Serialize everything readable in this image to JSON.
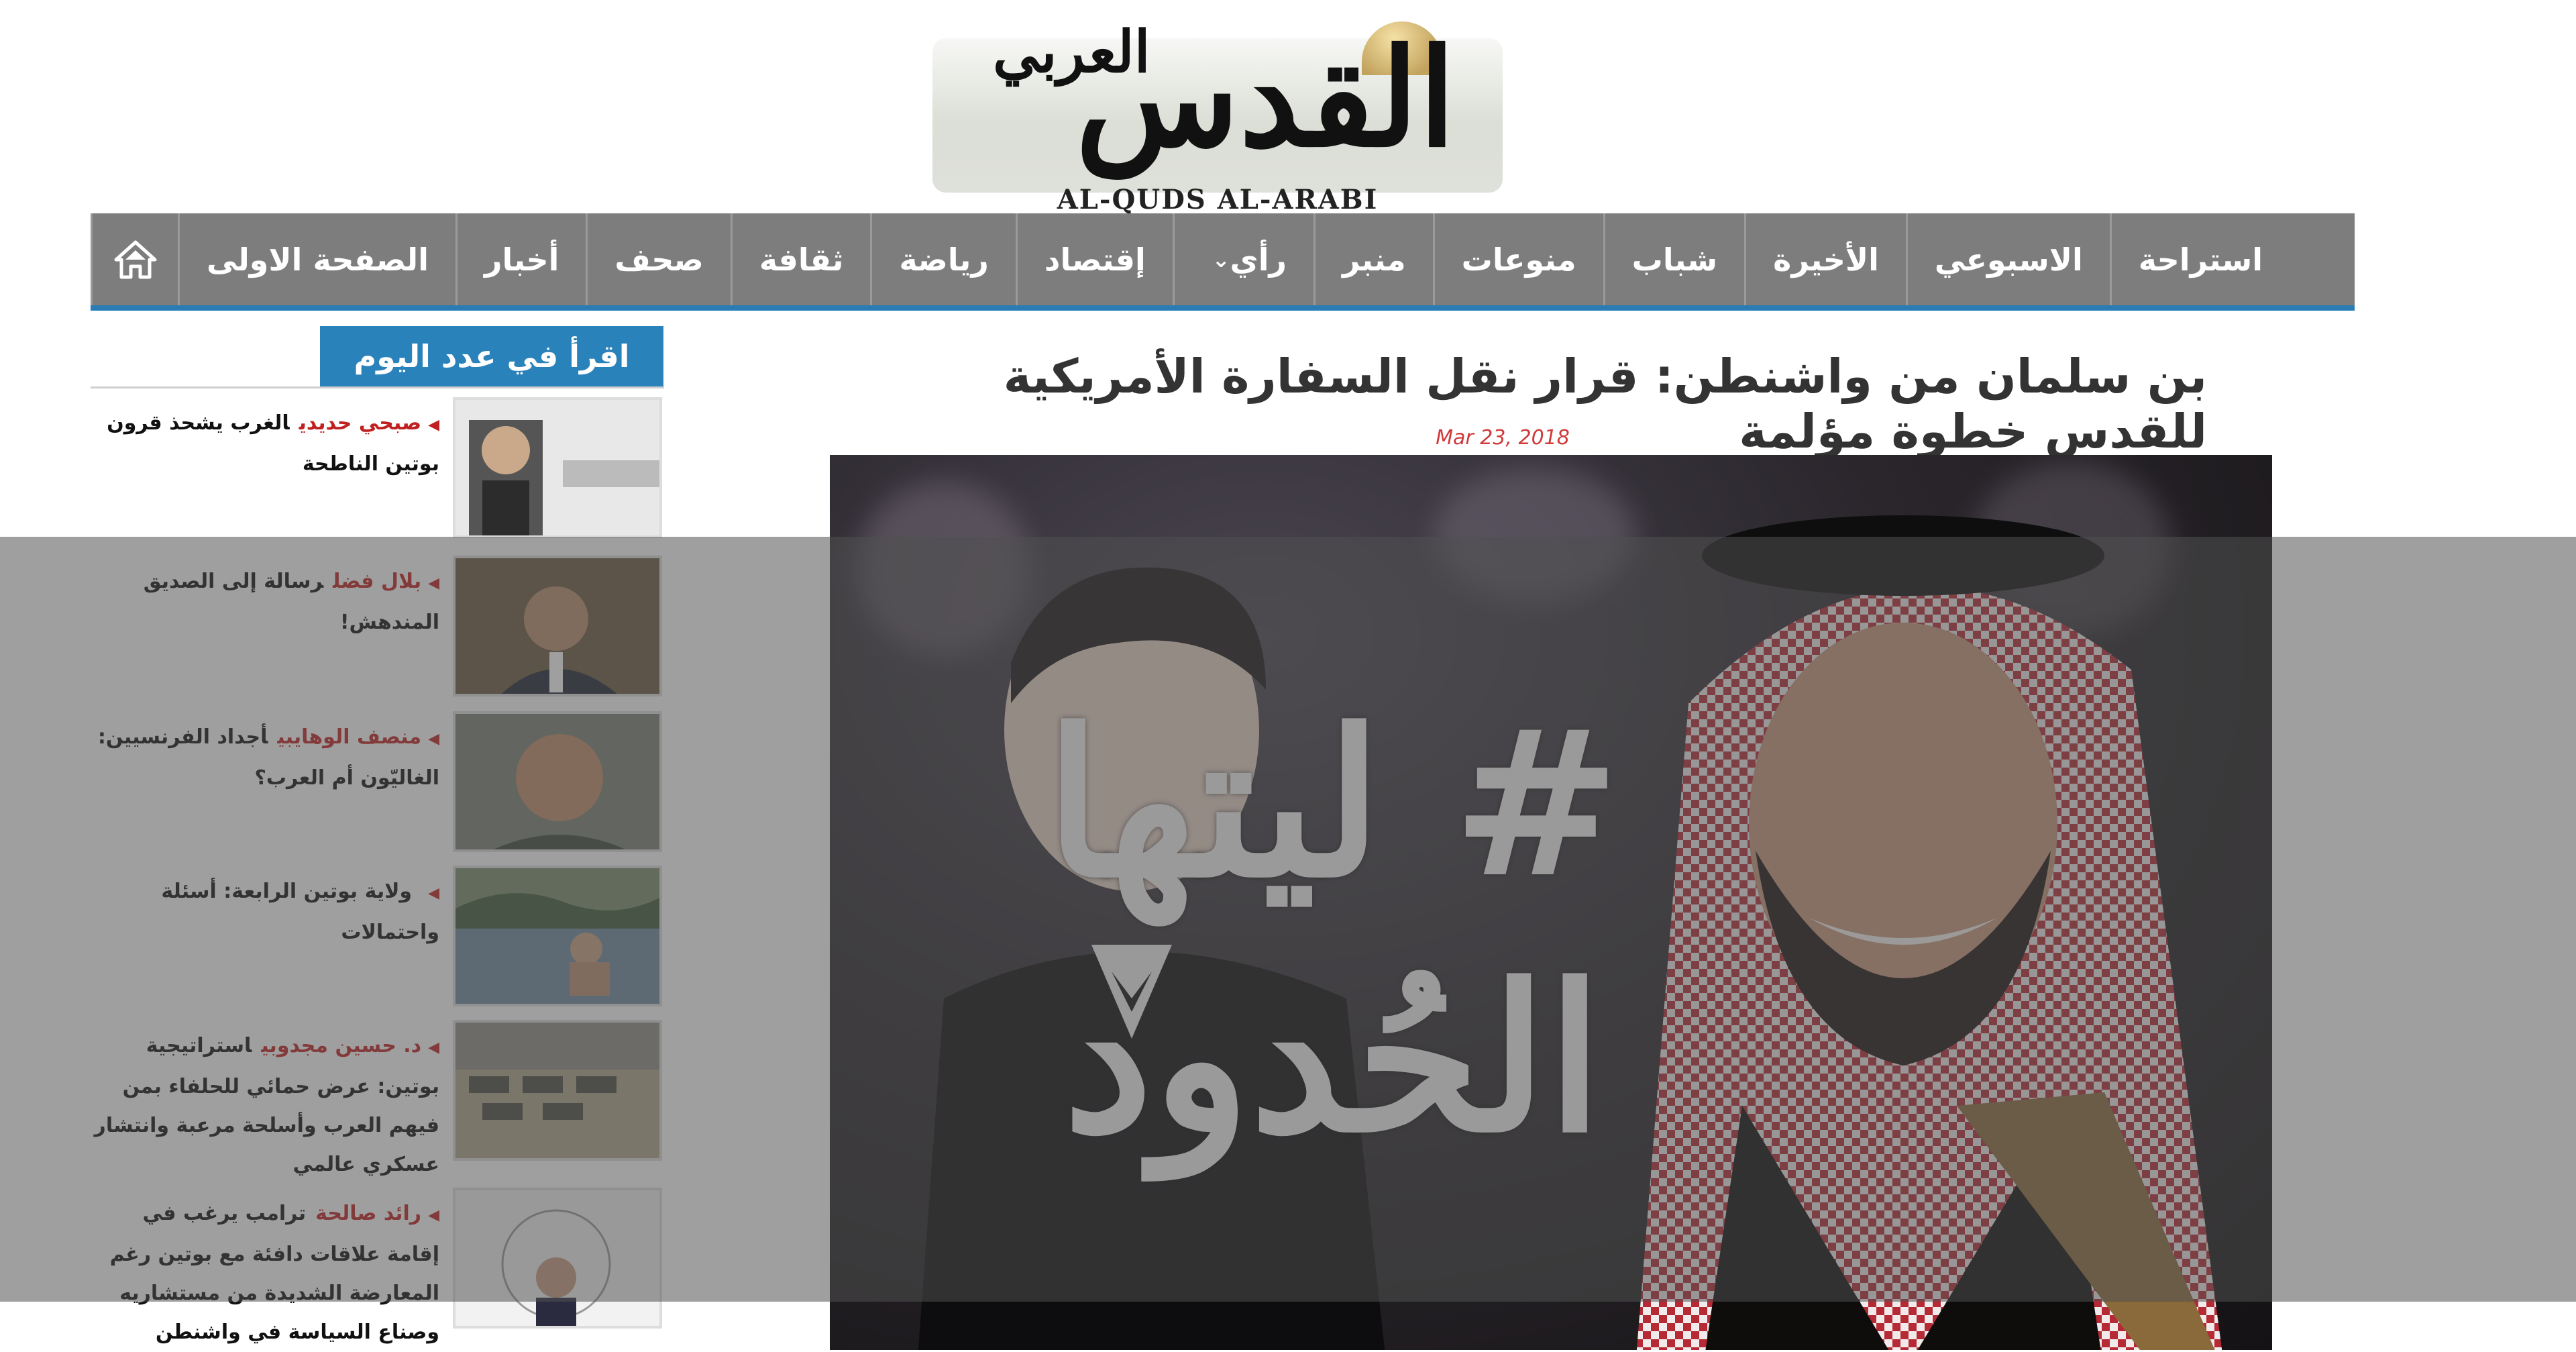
{
  "logo": {
    "main_ar": "القدس",
    "sub_ar": "العربي",
    "latin": "AL-QUDS AL-ARABI"
  },
  "nav": {
    "home_icon": "home-icon",
    "items": [
      {
        "label": "الصفحة الاولى"
      },
      {
        "label": "أخبار"
      },
      {
        "label": "صحف"
      },
      {
        "label": "ثقافة"
      },
      {
        "label": "رياضة"
      },
      {
        "label": "إقتصاد"
      },
      {
        "label": "رأي",
        "has_dropdown": true
      },
      {
        "label": "منبر"
      },
      {
        "label": "منوعات"
      },
      {
        "label": "شباب"
      },
      {
        "label": "الأخيرة"
      },
      {
        "label": "الاسبوعي"
      },
      {
        "label": "استراحة"
      }
    ]
  },
  "article": {
    "headline": "بن سلمان من واشنطن: قرار نقل السفارة الأمريكية للقدس خطوة مؤلمة",
    "date": "Mar 23, 2018",
    "hashtag_line1": "# ليتها",
    "hashtag_line2": "الحُدود"
  },
  "sidebar": {
    "title": "اقرأ في عدد اليوم",
    "items": [
      {
        "author": "صبحي حديدي",
        "title": "الغرب يشحذ قرون بوتين الناطحة",
        "thumb": "author-portrait"
      },
      {
        "author": "بلال فضل",
        "title": "رسالة إلى الصديق المندهش!",
        "thumb": "president-portrait"
      },
      {
        "author": "منصف الوهايبي",
        "title": "أجداد الفرنسيين: الغاليّون أم العرب؟",
        "thumb": "man-portrait"
      },
      {
        "author": "",
        "title": "ولاية بوتين الرابعة: أسئلة واحتمالات",
        "thumb": "lake-photo"
      },
      {
        "author": "د. حسين مجدوبي",
        "title": "استراتيجية بوتين: عرض حمائي للحلفاء بمن فيهم العرب وأسلحة مرعبة وانتشار عسكري عالمي",
        "thumb": "tanks-photo"
      },
      {
        "author": "رائد صالحة",
        "title": "ترامب يرغب في إقامة علاقات دافئة مع بوتين رغم المعارضة الشديدة من مستشاريه وصناع السياسة في واشنطن",
        "thumb": "newspaper-clip"
      }
    ]
  },
  "colors": {
    "nav_bg": "#7d7d7d",
    "nav_accent": "#2a7db4",
    "sidebar_title_bg": "#2a82bb",
    "author_red": "#c02020",
    "date_red": "#d03a3a"
  }
}
